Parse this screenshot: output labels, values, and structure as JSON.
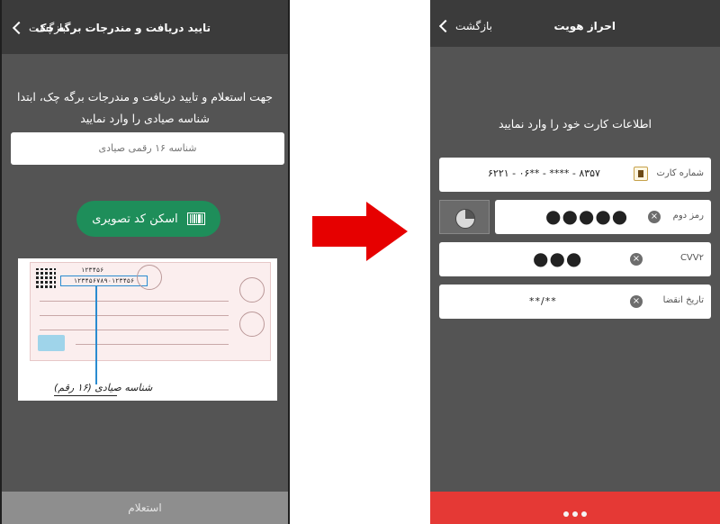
{
  "left": {
    "back_label": "بازگشت",
    "title": "تایید دریافت و مندرجات برگه چک",
    "instruction_line1": "جهت استعلام و تایید دریافت و مندرجات برگه چک، ابتدا",
    "instruction_line2": "شناسه صیادی را وارد نمایید",
    "sayadi_placeholder": "شناسه ۱۶ رقمی صیادی",
    "scan_button": "اسکن کد تصویری",
    "cheque_sayadi_short": "۱۲۳۴۵۶",
    "cheque_sayadi_full": "۱۲۳۴۵۶۷۸۹۰۱۲۳۴۵۶",
    "cheque_handwriting": "شناسه صیادی (۱۶ رقم)",
    "confirm_button": "استعلام"
  },
  "right": {
    "back_label": "بازگشت",
    "title": "احراز هویت",
    "instruction": "اطلاعات کارت خود را وارد نمایید",
    "card_number_label": "شماره کارت",
    "card_number_value": "۶۲۲۱ - ۰۶** - **** - ۸۳۵۷",
    "pin2_label": "رمز دوم",
    "pin2_value": "●●●●●",
    "cvv2_label": "CVV۲",
    "cvv2_value": "●●●",
    "expiry_label": "تاریخ انقضا",
    "expiry_value": "**/**",
    "clear_glyph": "×"
  },
  "colors": {
    "screen_bg": "#545454",
    "header_bg": "#3b3b3b",
    "scan_button": "#1e8e5a",
    "arrow": "#e60000",
    "bottom_bar": "#e53935"
  }
}
